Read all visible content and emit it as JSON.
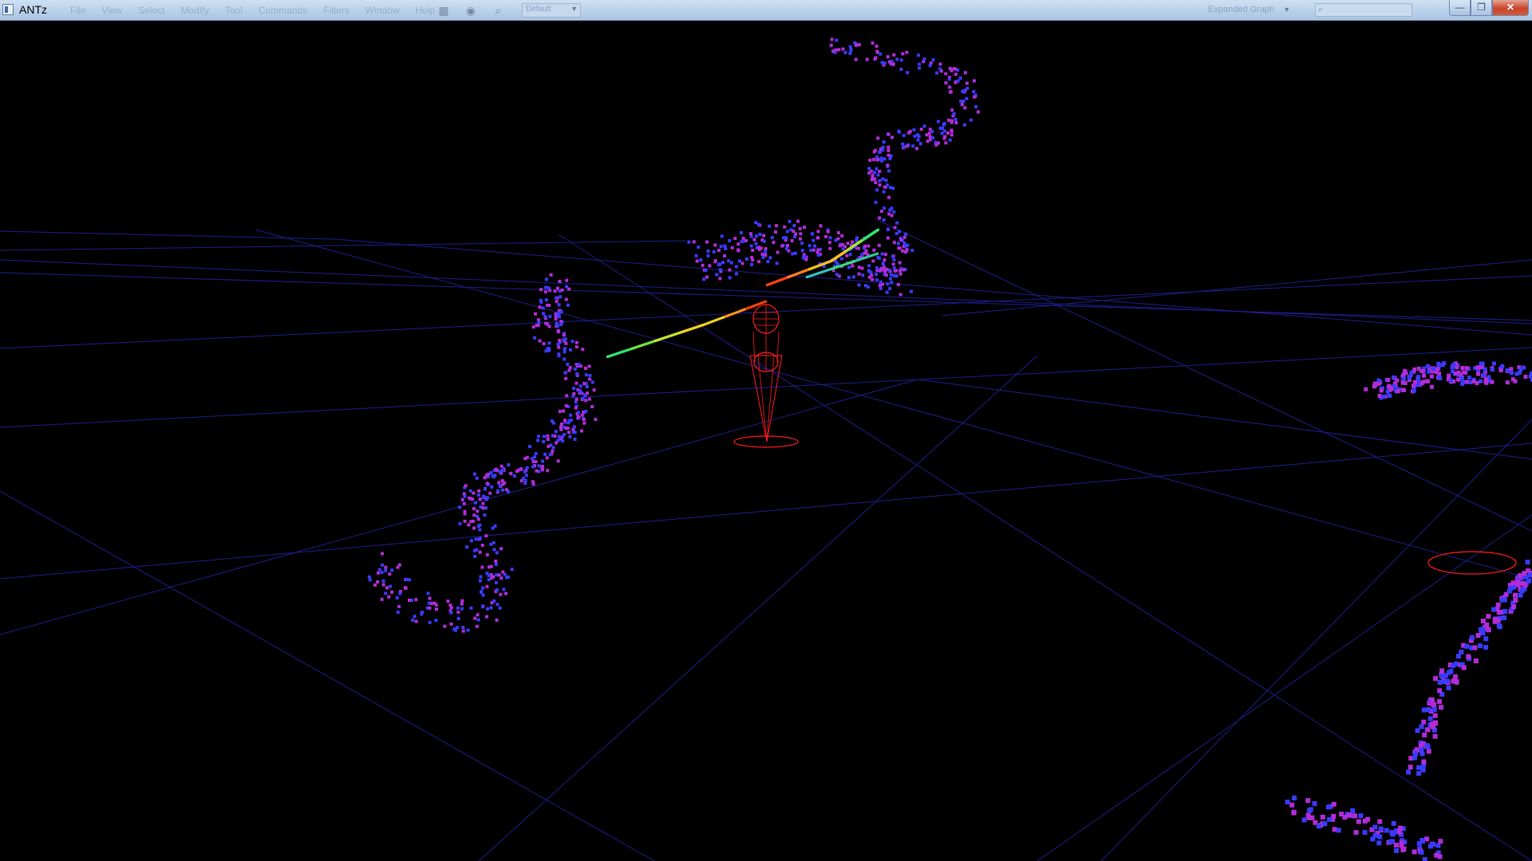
{
  "window": {
    "title": "ANTz",
    "controls": {
      "minimize": "—",
      "maximize": "❐",
      "close": "✕"
    }
  },
  "menu": [
    "File",
    "View",
    "Select",
    "Modify",
    "Tool",
    "Commands",
    "Filters",
    "Window",
    "Help"
  ],
  "toolbar": {
    "icons": [
      "grid-icon",
      "camera-icon",
      "zoom-icon"
    ],
    "view_select_value": "Default",
    "mode_select_value": "Expanded Graph"
  },
  "search": {
    "placeholder": ""
  },
  "colors": {
    "background": "#000000",
    "grid": "#1d1d8a",
    "pointer": "#ff1a1a",
    "point_low": "#b22cd8",
    "point_mid": "#3a3aff",
    "point_high": "#30e070"
  }
}
